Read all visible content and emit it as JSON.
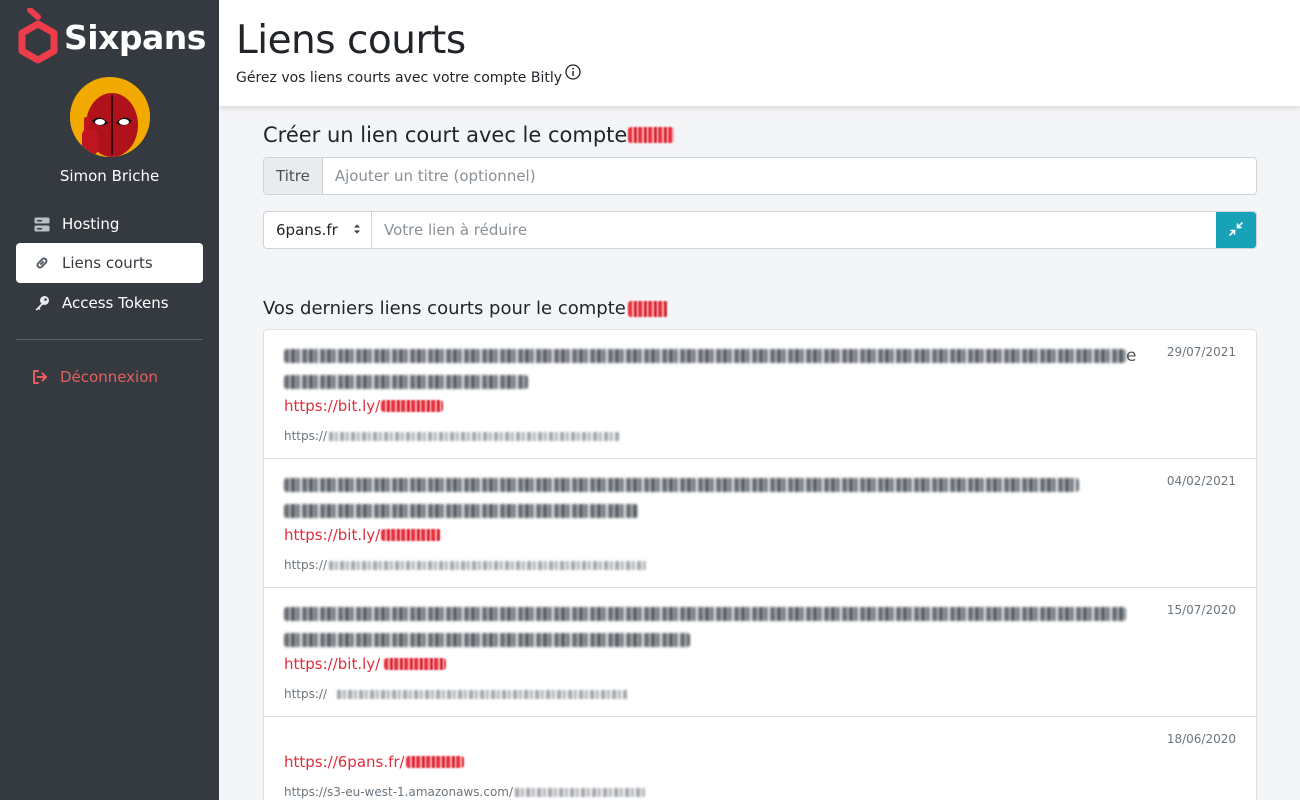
{
  "brand": {
    "name": "Sixpans",
    "color": "#ee3d4a"
  },
  "user": {
    "name": "Simon Briche"
  },
  "sidebar": {
    "items": [
      {
        "label": "Hosting",
        "icon": "server-icon"
      },
      {
        "label": "Liens courts",
        "icon": "link-icon",
        "active": true
      },
      {
        "label": "Access Tokens",
        "icon": "key-icon"
      }
    ],
    "logout_label": "Déconnexion"
  },
  "header": {
    "title": "Liens courts",
    "subtitle": "Gérez vos liens courts avec votre compte Bitly"
  },
  "create": {
    "heading": "Créer un lien court avec le compte",
    "title_addon": "Titre",
    "title_placeholder": "Ajouter un titre (optionnel)",
    "domain_selected": "6pans.fr",
    "link_placeholder": "Votre lien à réduire"
  },
  "list": {
    "heading": "Vos derniers liens courts pour le compte",
    "items": [
      {
        "date": "29/07/2021",
        "title_suffix": "e",
        "short_prefix": "https://bit.ly/",
        "long_prefix": "https://"
      },
      {
        "date": "04/02/2021",
        "title_suffix": "",
        "short_prefix": "https://bit.ly/",
        "long_prefix": "https://"
      },
      {
        "date": "15/07/2020",
        "title_suffix": "",
        "short_prefix": "https://bit.ly/",
        "long_prefix": "https://"
      },
      {
        "date": "18/06/2020",
        "title_suffix": "",
        "short_prefix": "https://6pans.fr/",
        "long_prefix": "https://s3-eu-west-1.amazonaws.com/"
      }
    ]
  },
  "colors": {
    "sidebar_bg": "#343a40",
    "accent_teal": "#17a2b8",
    "link_red": "#e02d3c",
    "logout_red": "#e4605e"
  }
}
